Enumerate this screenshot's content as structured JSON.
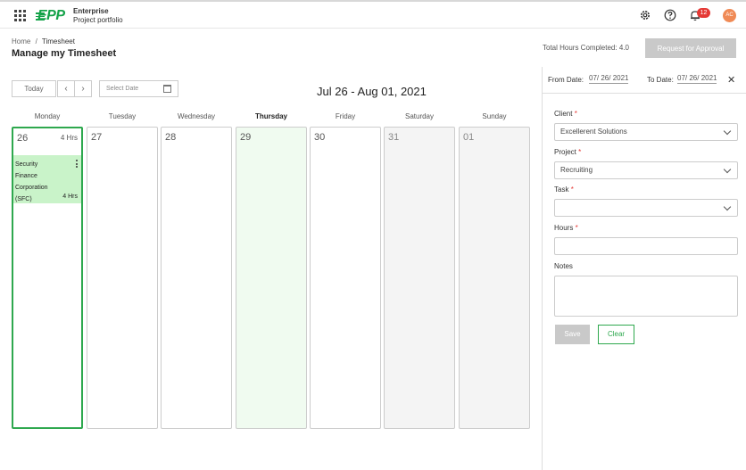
{
  "header": {
    "logo_mark": "EPP",
    "logo_line1": "Enterprise",
    "logo_line2": "Project portfolio",
    "notification_count": "12",
    "avatar_initials": "AC",
    "icons": [
      "apps-grid-icon",
      "settings-gear-icon",
      "help-icon",
      "bell-icon"
    ]
  },
  "breadcrumb": {
    "home": "Home",
    "separator": "/",
    "current": "Timesheet"
  },
  "page_title": "Manage my Timesheet",
  "total_hours": "Total Hours Completed: 4.0",
  "approval_button": "Request for Approval",
  "toolbar": {
    "today": "Today",
    "prev": "‹",
    "next": "›",
    "date_placeholder": "Select Date"
  },
  "week_title": "Jul 26 - Aug 01, 2021",
  "days": [
    {
      "name": "Monday",
      "date": "26",
      "hours": "4 Hrs"
    },
    {
      "name": "Tuesday",
      "date": "27"
    },
    {
      "name": "Wednesday",
      "date": "28"
    },
    {
      "name": "Thursday",
      "date": "29"
    },
    {
      "name": "Friday",
      "date": "30"
    },
    {
      "name": "Saturday",
      "date": "31"
    },
    {
      "name": "Sunday",
      "date": "01"
    }
  ],
  "entry": {
    "lines": [
      "Security",
      "Finance",
      "Corporation",
      "(SFC)"
    ],
    "hours": "4 Hrs"
  },
  "panel": {
    "from_label": "From Date:",
    "from_value": "07/ 26/ 2021",
    "to_label": "To Date:",
    "to_value": "07/ 26/ 2021",
    "client_label": "Client",
    "client_value": "Excellerent Solutions",
    "project_label": "Project",
    "project_value": "Recruiting",
    "task_label": "Task",
    "task_value": "",
    "hours_label": "Hours",
    "hours_value": "",
    "notes_label": "Notes",
    "required_mark": "*",
    "save": "Save",
    "clear": "Clear"
  },
  "colors": {
    "accent_green": "#2ea84e",
    "entry_bg": "#c9f3c9",
    "badge_red": "#e53935",
    "avatar": "#f08a55",
    "disabled_btn": "#c9c9c9"
  }
}
